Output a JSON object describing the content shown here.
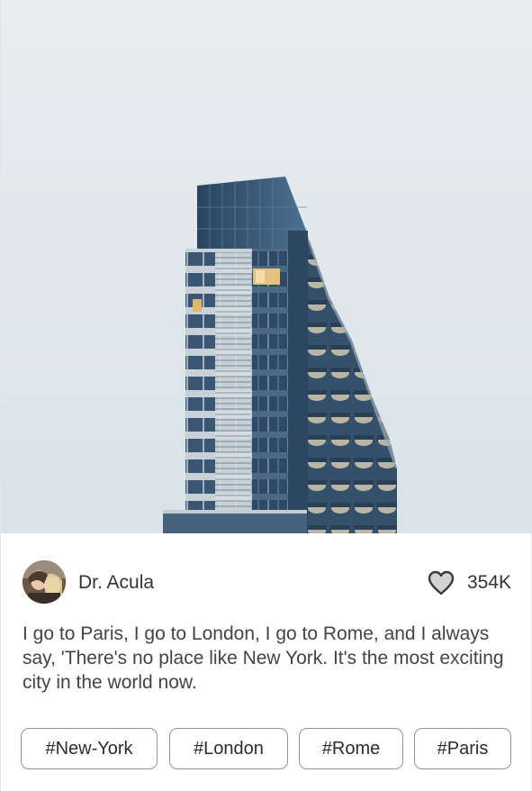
{
  "post": {
    "photo_alt": "Glass high-rise building against a pale sky",
    "author": "Dr. Acula",
    "likes": "354K",
    "caption": "I go to Paris, I go to London, I go to Rome, and I always say, 'There's no place like New York. It's the most exciting city in the world now.",
    "tags": [
      {
        "label": "#New-York"
      },
      {
        "label": "#London"
      },
      {
        "label": "#Rome"
      },
      {
        "label": "#Paris"
      }
    ]
  },
  "icons": {
    "like": "heart-icon"
  },
  "colors": {
    "sky": "#dfe7ea",
    "building_glass": "#2f4c66",
    "tag_border": "#8e9296",
    "text": "#333333"
  }
}
